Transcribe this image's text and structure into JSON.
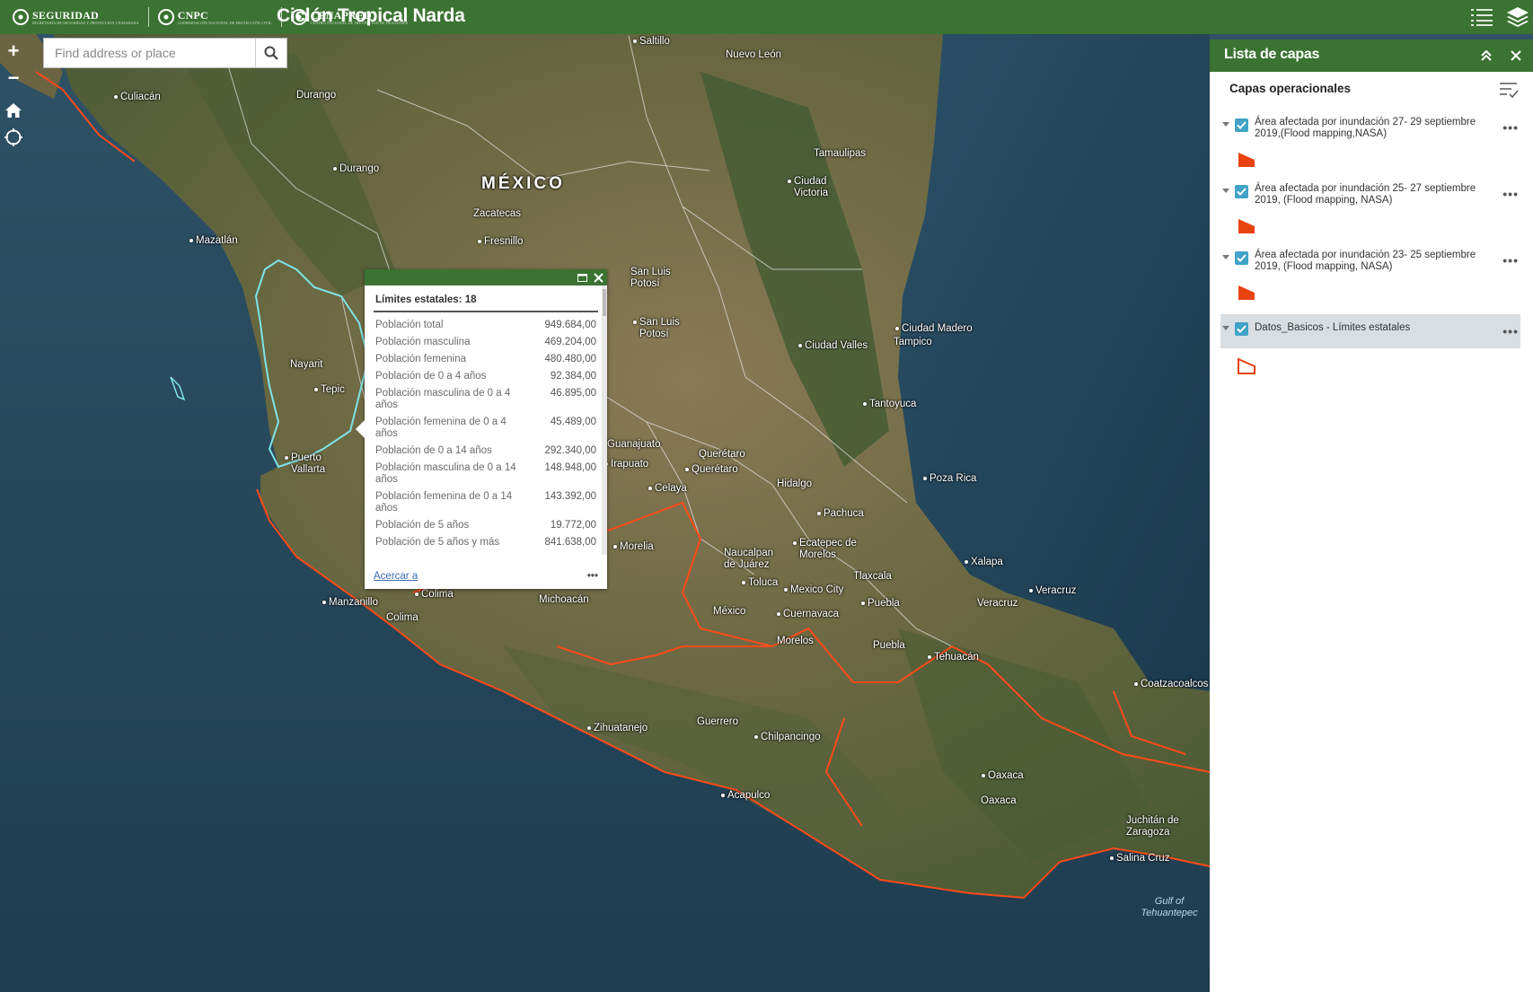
{
  "header": {
    "title": "Ciclón Tropical Narda",
    "logos": [
      {
        "name": "SEGURIDAD",
        "sub": "SECRETARÍA DE SEGURIDAD Y PROTECCIÓN CIUDADANA"
      },
      {
        "name": "CNPC",
        "sub": "COORDINACIÓN NACIONAL DE PROTECCIÓN CIVIL"
      },
      {
        "name": "CENAPRED",
        "sub": "CENTRO NACIONAL DE PREVENCIÓN DE DESASTRES"
      }
    ],
    "buttons": [
      {
        "name": "layer-list-icon"
      },
      {
        "name": "layers-icon"
      }
    ]
  },
  "search": {
    "placeholder": "Find address or place",
    "value": ""
  },
  "map_controls": {
    "zoom_in": "+",
    "zoom_out": "−",
    "home_icon": "home-icon",
    "locate_icon": "locate-icon"
  },
  "map_labels": {
    "country": "MÉXICO",
    "places": [
      "Saltillo",
      "Nuevo León",
      "Culiacán",
      "Durango",
      "Durango",
      "Tamaulipas",
      "Ciudad Victoria",
      "Zacatecas",
      "Fresnillo",
      "Mazatlán",
      "San Luis Potosí",
      "San Luis Potosí",
      "Ciudad Madero",
      "Tampico",
      "Ciudad Valles",
      "Nayarit",
      "Tepic",
      "Tantoyuca",
      "Puerto Vallarta",
      "Guanajuato",
      "Irapuato",
      "Querétaro",
      "Querétaro",
      "Celaya",
      "Hidalgo",
      "Poza Rica",
      "Pachuca",
      "Ecatepec de Morelos",
      "Morelia",
      "Naucalpan de Juárez",
      "Xalapa",
      "Tlaxcala",
      "Toluca",
      "Mexico City",
      "Veracruz",
      "Manzanillo",
      "Colima",
      "Colima",
      "Michoacán",
      "México",
      "Cuernavaca",
      "Puebla",
      "Veracruz",
      "Morelos",
      "Puebla",
      "Tehuacán",
      "Coatzacoalcos",
      "Zihuatanejo",
      "Guerrero",
      "Chilpancingo",
      "Acapulco",
      "Oaxaca",
      "Oaxaca",
      "Juchitán de Zaragoza",
      "Salina Cruz",
      "Gulf of Tehuantepec"
    ]
  },
  "popup": {
    "title": "Límites estatales: 18",
    "rows": [
      {
        "label": "Población total",
        "value": "949.684,00"
      },
      {
        "label": "Población masculina",
        "value": "469.204,00"
      },
      {
        "label": "Población femenina",
        "value": "480.480,00"
      },
      {
        "label": "Población de 0 a 4 años",
        "value": "92.384,00"
      },
      {
        "label": "Población masculina de 0 a 4 años",
        "value": "46.895,00"
      },
      {
        "label": "Población femenina de 0 a 4 años",
        "value": "45.489,00"
      },
      {
        "label": "Población de 0 a 14 años",
        "value": "292.340,00"
      },
      {
        "label": "Población masculina de 0 a 14 años",
        "value": "148.948,00"
      },
      {
        "label": "Población femenina de 0 a 14 años",
        "value": "143.392,00"
      },
      {
        "label": "Población de 5 años",
        "value": "19.772,00"
      },
      {
        "label": "Población de 5 años y más",
        "value": "841.638,00"
      }
    ],
    "zoom_link": "Acercar a",
    "more": "•••"
  },
  "layer_panel": {
    "title": "Lista de capas",
    "section": "Capas operacionales",
    "layers": [
      {
        "label": "Área afectada por inundación 27- 29 septiembre 2019,(Flood mapping,NASA)",
        "checked": true,
        "symbol_color": "#e8420f",
        "selected": false
      },
      {
        "label": "Área afectada por inundación 25- 27 septiembre 2019, (Flood mapping, NASA)",
        "checked": true,
        "symbol_color": "#e8420f",
        "selected": false
      },
      {
        "label": "Área afectada por inundación 23- 25 septiembre 2019, (Flood mapping, NASA)",
        "checked": true,
        "symbol_color": "#e8420f",
        "selected": false
      },
      {
        "label": "Datos_Basicos - Límites estatales",
        "checked": true,
        "symbol_color": "#e8420f",
        "selected": true
      }
    ],
    "more": "•••"
  },
  "colors": {
    "header_green": "#3b7332",
    "checkbox_blue": "#41a3c7",
    "boundary_red": "#ff4a1a",
    "selected_state": "#7fe3e6"
  }
}
